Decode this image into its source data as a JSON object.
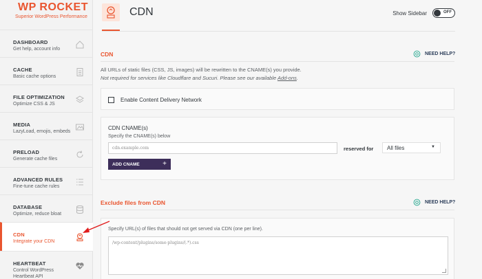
{
  "brand": {
    "logo_text": "WP ROCKET",
    "tagline": "Superior WordPress Performance"
  },
  "sidebar": {
    "items": [
      {
        "title": "DASHBOARD",
        "desc": "Get help, account info",
        "icon": "home-icon"
      },
      {
        "title": "CACHE",
        "desc": "Basic cache options",
        "icon": "document-icon"
      },
      {
        "title": "FILE OPTIMIZATION",
        "desc": "Optimize CSS & JS",
        "icon": "layers-icon"
      },
      {
        "title": "MEDIA",
        "desc": "LazyLoad, emojis, embeds",
        "icon": "image-icon"
      },
      {
        "title": "PRELOAD",
        "desc": "Generate cache files",
        "icon": "refresh-icon"
      },
      {
        "title": "ADVANCED RULES",
        "desc": "Fine-tune cache rules",
        "icon": "list-icon"
      },
      {
        "title": "DATABASE",
        "desc": "Optimize, reduce bloat",
        "icon": "database-icon"
      },
      {
        "title": "CDN",
        "desc": "Integrate your CDN",
        "icon": "cdn-icon",
        "active": true
      },
      {
        "title": "HEARTBEAT",
        "desc": "Control WordPress Heartbeat API",
        "icon": "heart-icon"
      }
    ]
  },
  "header": {
    "title": "CDN",
    "show_sidebar_label": "Show Sidebar",
    "toggle_state": "OFF",
    "badge_text": "CDN"
  },
  "cdn_section": {
    "title": "CDN",
    "need_help": "NEED HELP?",
    "desc1": "All URLs of static files (CSS, JS, images) will be rewritten to the CNAME(s) you provide.",
    "desc2_prefix": "Not required for services like Cloudflare and Sucuri. Please see our available ",
    "desc2_link": "Add-ons",
    "desc2_suffix": ".",
    "enable_label": "Enable Content Delivery Network",
    "cname_heading": "CDN CNAME(s)",
    "cname_sub": "Specify the CNAME(s) below",
    "cname_placeholder": "cdn.example.com",
    "reserved_for": "reserved for",
    "reserved_value": "All files",
    "add_cname": "ADD CNAME"
  },
  "exclude_section": {
    "title": "Exclude files from CDN",
    "need_help": "NEED HELP?",
    "desc": "Specify URL(s) of files that should not get served via CDN (one per line).",
    "placeholder": "/wp-content/plugins/some-plugins/(.*).css"
  },
  "colors": {
    "accent": "#e9552f",
    "dark": "#3d2e5a",
    "help": "#1fa58c"
  }
}
